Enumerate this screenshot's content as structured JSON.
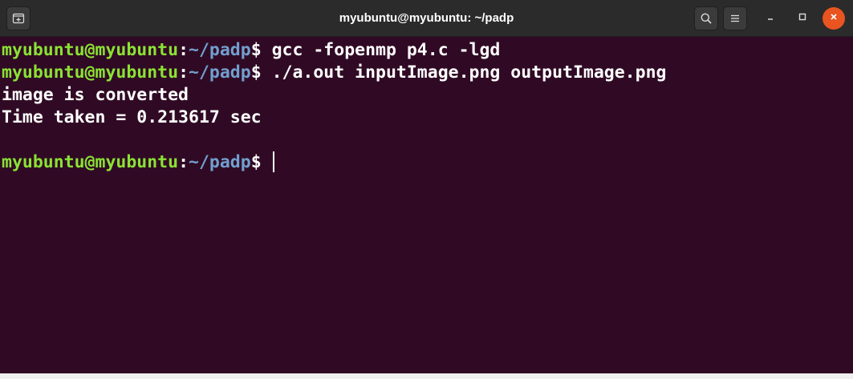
{
  "window": {
    "title": "myubuntu@myubuntu: ~/padp"
  },
  "titlebar": {
    "new_tab_icon": "new-tab-icon",
    "search_icon": "search-icon",
    "menu_icon": "hamburger-menu-icon",
    "minimize_icon": "minimize-icon",
    "maximize_icon": "maximize-icon",
    "close_icon": "close-icon"
  },
  "colors": {
    "background": "#300a24",
    "user_host": "#8ae234",
    "path": "#729fcf",
    "text": "#ffffff",
    "close_button": "#e95420"
  },
  "terminal": {
    "lines": [
      {
        "type": "prompt",
        "user_host": "myubuntu@myubuntu",
        "colon": ":",
        "path": "~/padp",
        "symbol": "$",
        "command": " gcc -fopenmp p4.c -lgd"
      },
      {
        "type": "prompt",
        "user_host": "myubuntu@myubuntu",
        "colon": ":",
        "path": "~/padp",
        "symbol": "$",
        "command": " ./a.out inputImage.png outputImage.png"
      },
      {
        "type": "output",
        "text": "image is converted"
      },
      {
        "type": "output",
        "text": "Time taken = 0.213617 sec"
      },
      {
        "type": "output",
        "text": ""
      },
      {
        "type": "prompt",
        "user_host": "myubuntu@myubuntu",
        "colon": ":",
        "path": "~/padp",
        "symbol": "$",
        "command": " "
      }
    ]
  }
}
